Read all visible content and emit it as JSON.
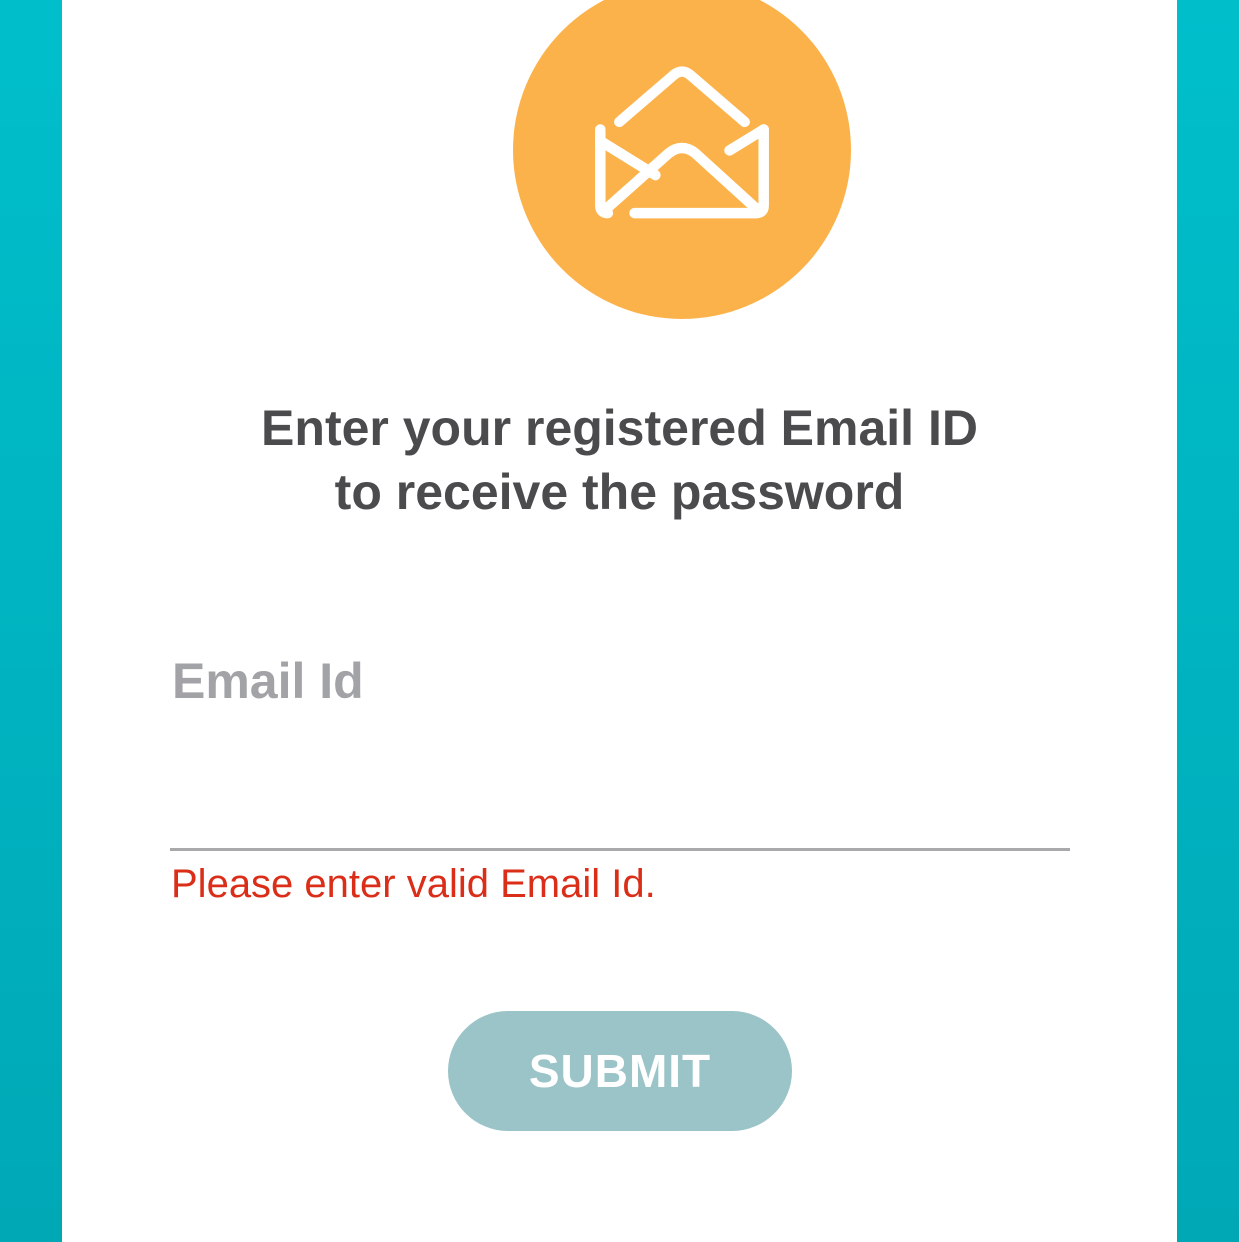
{
  "icon": "open-envelope-icon",
  "colors": {
    "background": "#00b4c2",
    "card": "#ffffff",
    "badge": "#fcb24a",
    "heading": "#4b4b4d",
    "label": "#a2a3a6",
    "error": "#db2e18",
    "button": "#9bc4c8"
  },
  "instruction": {
    "line1": "Enter your registered Email ID",
    "line2": "to receive the password"
  },
  "email_field": {
    "label": "Email Id",
    "value": ""
  },
  "error": "Please enter valid Email Id.",
  "submit_label": "SUBMIT"
}
